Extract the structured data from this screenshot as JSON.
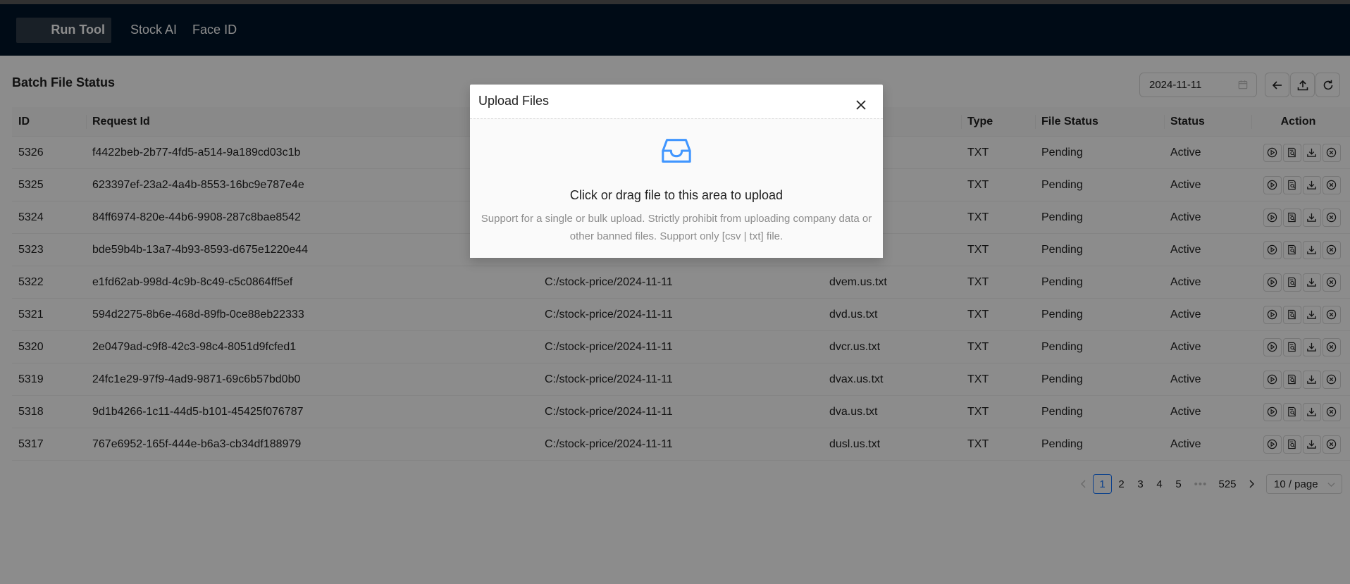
{
  "nav": {
    "items": [
      "Run Tool",
      "Stock AI",
      "Face ID"
    ]
  },
  "page": {
    "title": "Batch File Status",
    "date_value": "2024-11-11"
  },
  "table": {
    "headers": [
      "ID",
      "Request Id",
      "",
      "",
      "Type",
      "File Status",
      "Status",
      "Action"
    ],
    "rows": [
      [
        "5326",
        "f4422beb-2b77-4fd5-a514-9a189cd03c1b",
        "",
        "",
        "TXT",
        "Pending",
        "Active"
      ],
      [
        "5325",
        "623397ef-23a2-4a4b-8553-16bc9e787e4e",
        "",
        "",
        "TXT",
        "Pending",
        "Active"
      ],
      [
        "5324",
        "84ff6974-820e-44b6-9908-287c8bae8542",
        "",
        "",
        "TXT",
        "Pending",
        "Active"
      ],
      [
        "5323",
        "bde59b4b-13a7-4b93-8593-d675e1220e44",
        "",
        "",
        "TXT",
        "Pending",
        "Active"
      ],
      [
        "5322",
        "e1fd62ab-998d-4c9b-8c49-c5c0864ff5ef",
        "C:/stock-price/2024-11-11",
        "dvem.us.txt",
        "TXT",
        "Pending",
        "Active"
      ],
      [
        "5321",
        "594d2275-8b6e-468d-89fb-0ce88eb22333",
        "C:/stock-price/2024-11-11",
        "dvd.us.txt",
        "TXT",
        "Pending",
        "Active"
      ],
      [
        "5320",
        "2e0479ad-c9f8-42c3-98c4-8051d9fcfed1",
        "C:/stock-price/2024-11-11",
        "dvcr.us.txt",
        "TXT",
        "Pending",
        "Active"
      ],
      [
        "5319",
        "24fc1e29-97f9-4ad9-9871-69c6b57bd0b0",
        "C:/stock-price/2024-11-11",
        "dvax.us.txt",
        "TXT",
        "Pending",
        "Active"
      ],
      [
        "5318",
        "9d1b4266-1c11-44d5-b101-45425f076787",
        "C:/stock-price/2024-11-11",
        "dva.us.txt",
        "TXT",
        "Pending",
        "Active"
      ],
      [
        "5317",
        "767e6952-165f-444e-b6a3-cb34df188979",
        "C:/stock-price/2024-11-11",
        "dusl.us.txt",
        "TXT",
        "Pending",
        "Active"
      ]
    ],
    "row_action_icons": [
      "play-icon",
      "search-file-icon",
      "download-icon",
      "close-circle-icon"
    ]
  },
  "pagination": {
    "pages": [
      "1",
      "2",
      "3",
      "4",
      "5"
    ],
    "ellipsis": "•••",
    "last_page": "525",
    "current": "1",
    "page_size": "10 / page"
  },
  "toolbar_icons": [
    "calendar-icon",
    "arrow-left-icon",
    "upload-icon",
    "refresh-icon"
  ],
  "modal": {
    "title": "Upload Files",
    "drop_text": "Click or drag file to this area to upload",
    "hint": "Support for a single or bulk upload. Strictly prohibit from uploading company data or other banned files. Support only [csv | txt] file."
  },
  "colors": {
    "navbar": "#001529",
    "accent": "#1677ff",
    "overlay": "rgba(0,0,0,0.45)"
  }
}
